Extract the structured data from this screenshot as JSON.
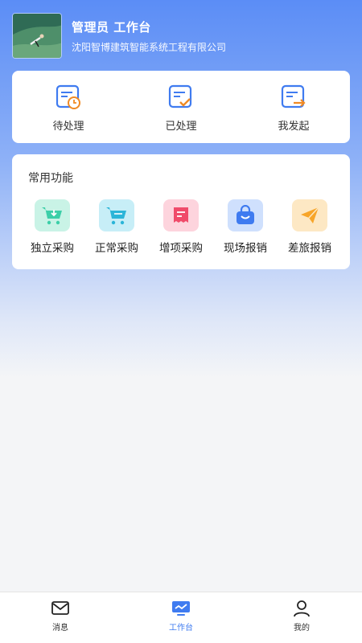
{
  "header": {
    "title": "管理员 工作台",
    "company": "沈阳智博建筑智能系统工程有限公司"
  },
  "todo": [
    {
      "label": "待处理",
      "icon": "pending-doc-icon"
    },
    {
      "label": "已处理",
      "icon": "done-doc-icon"
    },
    {
      "label": "我发起",
      "icon": "initiated-doc-icon"
    }
  ],
  "functions": {
    "title": "常用功能",
    "items": [
      {
        "label": "独立采购",
        "icon": "cart-download-icon",
        "color": "#3ccfa8"
      },
      {
        "label": "正常采购",
        "icon": "cart-icon",
        "color": "#2bb5d8"
      },
      {
        "label": "增项采购",
        "icon": "receipt-icon",
        "color": "#f04b6a"
      },
      {
        "label": "现场报销",
        "icon": "bag-icon",
        "color": "#3f7bf0"
      },
      {
        "label": "差旅报销",
        "icon": "paper-plane-icon",
        "color": "#f7a529"
      }
    ]
  },
  "tabbar": {
    "items": [
      {
        "label": "消息",
        "icon": "mail-icon"
      },
      {
        "label": "工作台",
        "icon": "monitor-icon"
      },
      {
        "label": "我的",
        "icon": "user-icon"
      }
    ],
    "active_index": 1,
    "accent": "#3f7bf0"
  }
}
